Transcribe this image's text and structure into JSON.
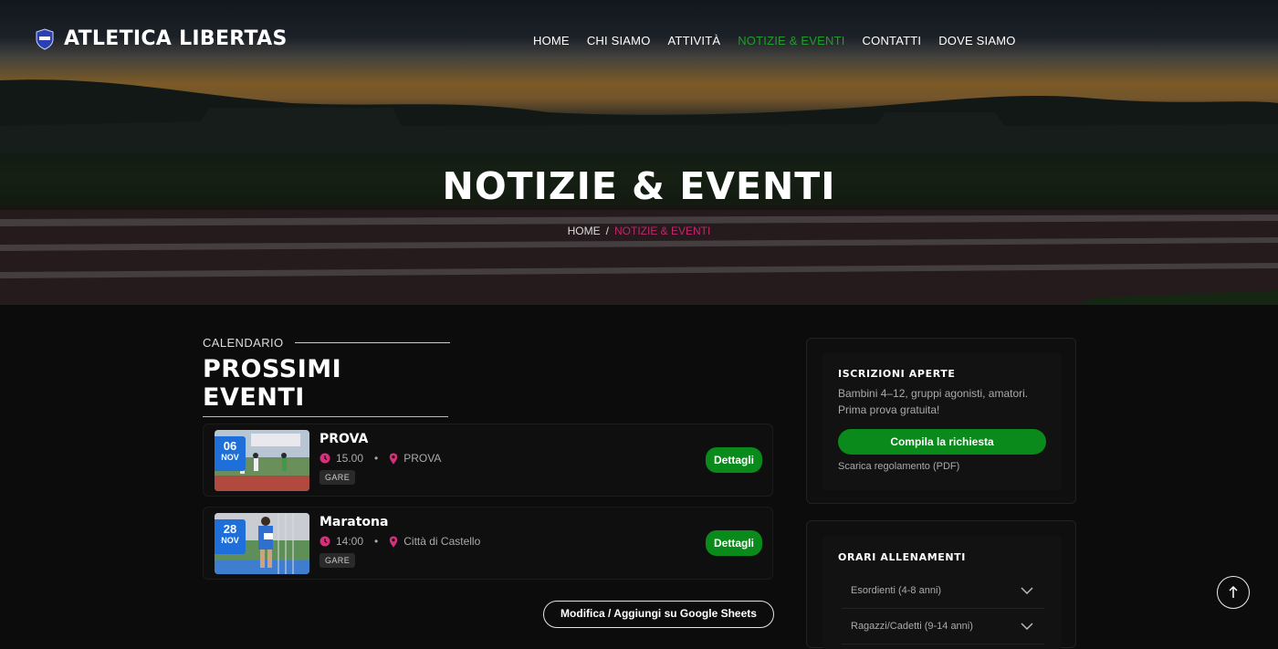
{
  "brand": {
    "name": "ATLETICA LIBERTAS",
    "logo_icon": "club-shield-icon"
  },
  "nav": {
    "items": [
      {
        "label": "HOME",
        "active": false
      },
      {
        "label": "CHI SIAMO",
        "active": false
      },
      {
        "label": "ATTIVITÀ",
        "active": false
      },
      {
        "label": "NOTIZIE & EVENTI",
        "active": true
      },
      {
        "label": "CONTATTI",
        "active": false
      },
      {
        "label": "DOVE SIAMO",
        "active": false
      }
    ]
  },
  "hero": {
    "title": "NOTIZIE & EVENTI"
  },
  "breadcrumb": {
    "home": "HOME",
    "separator": "/",
    "current": "NOTIZIE & EVENTI"
  },
  "events_section": {
    "kicker": "CALENDARIO",
    "title": "PROSSIMI EVENTI"
  },
  "events": [
    {
      "day": "06",
      "month": "NOV",
      "title": "PROVA",
      "time": "15.00",
      "location": "PROVA",
      "tag": "GARE",
      "button": "Dettagli"
    },
    {
      "day": "28",
      "month": "NOV",
      "title": "Maratona",
      "time": "14:00",
      "location": "Città di Castello",
      "tag": "GARE",
      "button": "Dettagli"
    }
  ],
  "sheets_button": "Modifica / Aggiungi su Google Sheets",
  "signup_card": {
    "title": "ISCRIZIONI APERTE",
    "text_line1": "Bambini 4–12, gruppi agonisti, amatori.",
    "text_line2": "Prima prova gratuita!",
    "cta": "Compila la richiesta",
    "pdf_link": "Scarica regolamento (PDF)"
  },
  "training_card": {
    "title": "ORARI ALLENAMENTI",
    "items": [
      "Esordienti (4-8 anni)",
      "Ragazzi/Cadetti (9-14 anni)"
    ]
  },
  "colors": {
    "accent_green": "#0a8a1a",
    "active_nav": "#1e9e2a",
    "breadcrumb_current": "#c3276d",
    "date_badge": "#1e6fd9"
  }
}
